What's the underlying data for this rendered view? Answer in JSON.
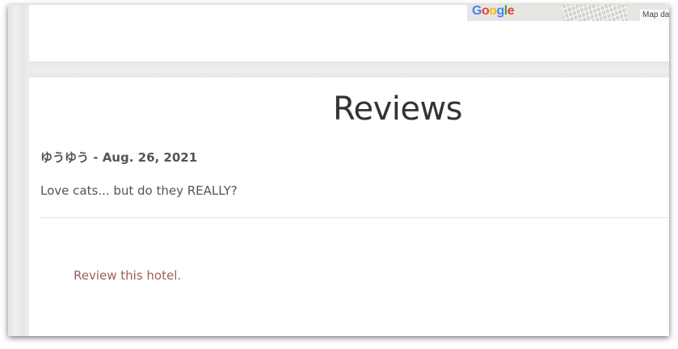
{
  "map": {
    "logo_letters": [
      "G",
      "o",
      "o",
      "g",
      "l",
      "e"
    ],
    "logo_colors": [
      "#4285F4",
      "#EA4335",
      "#FBBC05",
      "#4285F4",
      "#34A853",
      "#EA4335"
    ],
    "attribution": "Map da"
  },
  "reviews": {
    "title": "Reviews",
    "items": [
      {
        "author": "ゆうゆう",
        "separator": " - ",
        "date": "Aug. 26, 2021",
        "text": "Love cats... but do they REALLY?"
      }
    ],
    "review_link": "Review this hotel."
  },
  "colors": {
    "text": "#555555",
    "title": "#333333",
    "link": "#9c5e5e"
  }
}
